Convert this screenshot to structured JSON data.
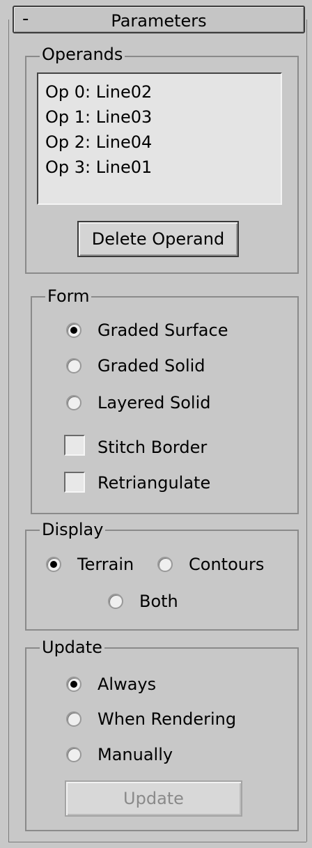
{
  "rollout": {
    "collapse_symbol": "-",
    "title": "Parameters"
  },
  "operands": {
    "group_title": "Operands",
    "items": [
      "Op 0: Line02",
      "Op 1: Line03",
      "Op 2: Line04",
      "Op 3: Line01"
    ],
    "delete_button": "Delete Operand"
  },
  "form": {
    "group_title": "Form",
    "options": [
      {
        "label": "Graded Surface",
        "checked": true
      },
      {
        "label": "Graded Solid",
        "checked": false
      },
      {
        "label": "Layered Solid",
        "checked": false
      }
    ],
    "checkboxes": [
      {
        "label": "Stitch Border",
        "checked": false
      },
      {
        "label": "Retriangulate",
        "checked": false
      }
    ]
  },
  "display": {
    "group_title": "Display",
    "options": [
      {
        "label": "Terrain",
        "checked": true
      },
      {
        "label": "Contours",
        "checked": false
      },
      {
        "label": "Both",
        "checked": false
      }
    ]
  },
  "update": {
    "group_title": "Update",
    "options": [
      {
        "label": "Always",
        "checked": true
      },
      {
        "label": "When Rendering",
        "checked": false
      },
      {
        "label": "Manually",
        "checked": false
      }
    ],
    "update_button": "Update",
    "update_button_enabled": false
  }
}
